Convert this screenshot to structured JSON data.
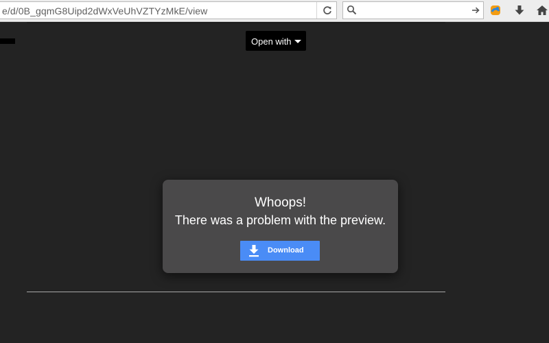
{
  "browser": {
    "url": "e/d/0B_gqmG8Uipd2dWxVeUhVZTYzMkE/view",
    "search_value": "",
    "icons": {
      "reload": "reload-icon",
      "search": "search-icon",
      "go": "arrow-right-icon",
      "addon": "addon-icon",
      "downloads": "download-arrow-icon",
      "home": "home-icon"
    }
  },
  "viewer": {
    "open_with_label": "Open with",
    "error_title": "Whoops!",
    "error_message": "There was a problem with the preview.",
    "download_label": "Download"
  },
  "colors": {
    "background": "#232323",
    "card": "#4a494a",
    "download_button": "#4a8cf6",
    "open_with_bg": "#000000"
  }
}
